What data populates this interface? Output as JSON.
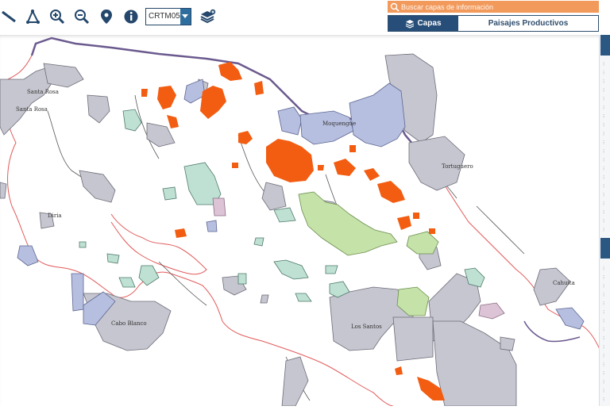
{
  "toolbar": {
    "tools": [
      {
        "name": "measure-line-icon"
      },
      {
        "name": "measure-area-icon"
      },
      {
        "name": "zoom-in-icon"
      },
      {
        "name": "zoom-out-icon"
      },
      {
        "name": "location-pin-icon"
      },
      {
        "name": "info-icon"
      }
    ],
    "projection": "CRTM05",
    "add_layers_icon": "layers-add-icon"
  },
  "search": {
    "placeholder": "Buscar capas de información"
  },
  "tabs": [
    {
      "label": "Capas",
      "active": true,
      "icon": "layers-icon"
    },
    {
      "label": "Paisajes Productivos",
      "active": false
    }
  ],
  "map": {
    "labels": {
      "santa_rosa_1": "Santa Rosa",
      "santa_rosa_2": "Santa Rosa",
      "moquenque": "Moquengue",
      "tortuguero": "Tortuguero",
      "cahuita": "Cahuita",
      "cabo_blanco": "Cabo Blanco",
      "los_santos": "Los Santos",
      "diria": "Diria"
    },
    "colors": {
      "protected_area": "#c6c6d0",
      "wetland": "#b7bfe0",
      "forest_reserve": "#bfe1d4",
      "corridor": "#c5e2a8",
      "private_reserve": "#dcc4d6",
      "fire_points": "#f25d12",
      "country_border": "#6b5a8e",
      "coastline": "#e25a5a",
      "rivers": "#555555",
      "accent": "#264e78",
      "search_bg": "#f29a5c"
    }
  }
}
